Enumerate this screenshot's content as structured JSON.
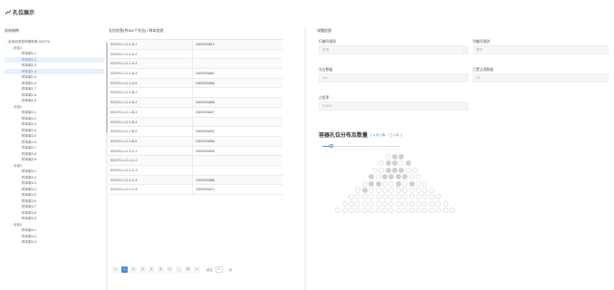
{
  "page": {
    "title": "孔位展示"
  },
  "tree": {
    "title": "冻存结构",
    "rows": [
      {
        "label": "全自动冻存存储系统-0312YU",
        "level": 0,
        "caret": "⌄",
        "selected": false
      },
      {
        "label": "分区1",
        "level": 1,
        "caret": "⌄",
        "selected": false
      },
      {
        "label": "样本架1-1",
        "level": 2,
        "caret": "",
        "selected": false
      },
      {
        "label": "样本架1-2",
        "level": 2,
        "caret": "",
        "selected": true
      },
      {
        "label": "样本架1-3",
        "level": 2,
        "caret": "",
        "selected": false
      },
      {
        "label": "样本架1-4",
        "level": 2,
        "caret": "",
        "selected": true
      },
      {
        "label": "样本架1-5",
        "level": 2,
        "caret": "",
        "selected": false
      },
      {
        "label": "样本架1-6",
        "level": 2,
        "caret": "",
        "selected": false
      },
      {
        "label": "样本架1-7",
        "level": 2,
        "caret": "",
        "selected": false
      },
      {
        "label": "样本架1-8",
        "level": 2,
        "caret": "",
        "selected": false
      },
      {
        "label": "样本架1-9",
        "level": 2,
        "caret": "",
        "selected": false
      },
      {
        "label": "分区2",
        "level": 1,
        "caret": "⌄",
        "selected": false
      },
      {
        "label": "样本架2-1",
        "level": 2,
        "caret": "",
        "selected": false
      },
      {
        "label": "样本架2-2",
        "level": 2,
        "caret": "",
        "selected": false
      },
      {
        "label": "样本架2-3",
        "level": 2,
        "caret": "",
        "selected": false
      },
      {
        "label": "样本架2-4",
        "level": 2,
        "caret": "",
        "selected": false
      },
      {
        "label": "样本架2-5",
        "level": 2,
        "caret": "",
        "selected": false
      },
      {
        "label": "样本架2-6",
        "level": 2,
        "caret": "",
        "selected": false
      },
      {
        "label": "样本架2-7",
        "level": 2,
        "caret": "",
        "selected": false
      },
      {
        "label": "样本架2-8",
        "level": 2,
        "caret": "",
        "selected": false
      },
      {
        "label": "样本架2-9",
        "level": 2,
        "caret": "",
        "selected": false
      },
      {
        "label": "分区3",
        "level": 1,
        "caret": "⌄",
        "selected": false
      },
      {
        "label": "样本架3-1",
        "level": 2,
        "caret": "",
        "selected": false
      },
      {
        "label": "样本架3-2",
        "level": 2,
        "caret": "",
        "selected": false
      },
      {
        "label": "样本架3-3",
        "level": 2,
        "caret": "",
        "selected": false
      },
      {
        "label": "样本架3-4",
        "level": 2,
        "caret": "",
        "selected": false
      },
      {
        "label": "样本架3-5",
        "level": 2,
        "caret": "",
        "selected": false
      },
      {
        "label": "样本架3-6",
        "level": 2,
        "caret": "",
        "selected": false
      },
      {
        "label": "样本架3-7",
        "level": 2,
        "caret": "",
        "selected": false
      },
      {
        "label": "样本架3-8",
        "level": 2,
        "caret": "",
        "selected": false
      },
      {
        "label": "样本架3-9",
        "level": 2,
        "caret": "",
        "selected": false
      },
      {
        "label": "分区4",
        "level": 1,
        "caret": "⌄",
        "selected": false
      },
      {
        "label": "样本架4-1",
        "level": 2,
        "caret": "",
        "selected": false
      },
      {
        "label": "样本架4-2",
        "level": 2,
        "caret": "",
        "selected": false
      },
      {
        "label": "样本架4-3",
        "level": 2,
        "caret": "",
        "selected": false
      }
    ]
  },
  "table": {
    "title": "孔位信息(共341个孔位) / 样本信息",
    "rows": [
      {
        "position": "0312YU-1-2-1-A-1",
        "sample": "G602094819"
      },
      {
        "position": "0312YU-1-2-1-A-2",
        "sample": ""
      },
      {
        "position": "0312YU-1-2-1-A-3",
        "sample": ""
      },
      {
        "position": "0312YU-1-2-1-A-4",
        "sample": "G602094882"
      },
      {
        "position": "0312YU-1-2-1-A-5",
        "sample": "G602094886"
      },
      {
        "position": "0312YU-1-2-1-B-1",
        "sample": ""
      },
      {
        "position": "0312YU-1-2-1-B-2",
        "sample": "G602094886"
      },
      {
        "position": "0312YU-1-2-1-B-3",
        "sample": "G602094847"
      },
      {
        "position": "0312YU-1-2-1-B-4",
        "sample": ""
      },
      {
        "position": "0312YU-1-2-1-B-5",
        "sample": "G602094832"
      },
      {
        "position": "0312YU-1-2-1-B-6",
        "sample": "G602094868"
      },
      {
        "position": "0312YU-1-2-1-C-1",
        "sample": "G602094836"
      },
      {
        "position": "0312YU-1-2-1-C-2",
        "sample": ""
      },
      {
        "position": "0312YU-1-2-1-C-3",
        "sample": ""
      },
      {
        "position": "0312YU-1-2-1-C-4",
        "sample": "G602094886"
      },
      {
        "position": "0312YU-1-2-1-C-5",
        "sample": "G602094871"
      }
    ],
    "pager": {
      "prev": "<",
      "pages": [
        "1",
        "2",
        "3",
        "4",
        "5",
        "6",
        "...",
        "23"
      ],
      "active": 0,
      "next": ">",
      "goto_label": "前往",
      "goto_value": "1",
      "goto_suffix": "页"
    }
  },
  "detail": {
    "title": "详细信息",
    "fields": {
      "row_rule_label": "行编号规则",
      "row_rule_value": "字母",
      "col_rule_label": "列编号规则",
      "col_rule_value": "数字",
      "hole_count_label": "孔位数量",
      "hole_count_value": "341",
      "used_count_label": "已置占用数量",
      "used_count_value": "23",
      "ratio_label": "占用率",
      "ratio_value": "6.80%"
    },
    "distribution_title": "容器孔位分布及数量",
    "legend": {
      "open": "(",
      "not_stored": "● 未入库",
      "stored": "○ 已入库",
      "close": ")"
    },
    "slider": {
      "value": 0.12
    }
  },
  "colors": {
    "accent": "#4a90d9",
    "selected_bg": "#e8f1fb",
    "hole_full": "#d0d0d0",
    "hole_empty": "#ffffff"
  },
  "hole_grid": {
    "rows": [
      {
        "count": 3,
        "full": [
          false,
          true,
          true
        ]
      },
      {
        "count": 5,
        "full": [
          false,
          true,
          true,
          false,
          true
        ]
      },
      {
        "count": 7,
        "full": [
          false,
          false,
          true,
          true,
          true,
          false,
          false
        ]
      },
      {
        "count": 8,
        "full": [
          true,
          false,
          true,
          true,
          true,
          true,
          false,
          false
        ]
      },
      {
        "count": 10,
        "full": [
          false,
          true,
          true,
          false,
          false,
          true,
          false,
          true,
          false,
          false
        ]
      },
      {
        "count": 12,
        "full": [
          false,
          true,
          false,
          false,
          false,
          false,
          false,
          false,
          false,
          false,
          false,
          false
        ]
      },
      {
        "count": 14,
        "full": [
          false,
          false,
          false,
          false,
          false,
          false,
          false,
          false,
          false,
          false,
          false,
          false,
          false,
          false
        ]
      },
      {
        "count": 16,
        "full": [
          false,
          false,
          false,
          false,
          false,
          false,
          false,
          false,
          false,
          false,
          false,
          false,
          false,
          false,
          false,
          false
        ]
      },
      {
        "count": 18,
        "full": [
          false,
          false,
          false,
          false,
          false,
          false,
          false,
          false,
          false,
          false,
          false,
          false,
          false,
          false,
          false,
          false,
          false,
          false
        ]
      }
    ]
  }
}
